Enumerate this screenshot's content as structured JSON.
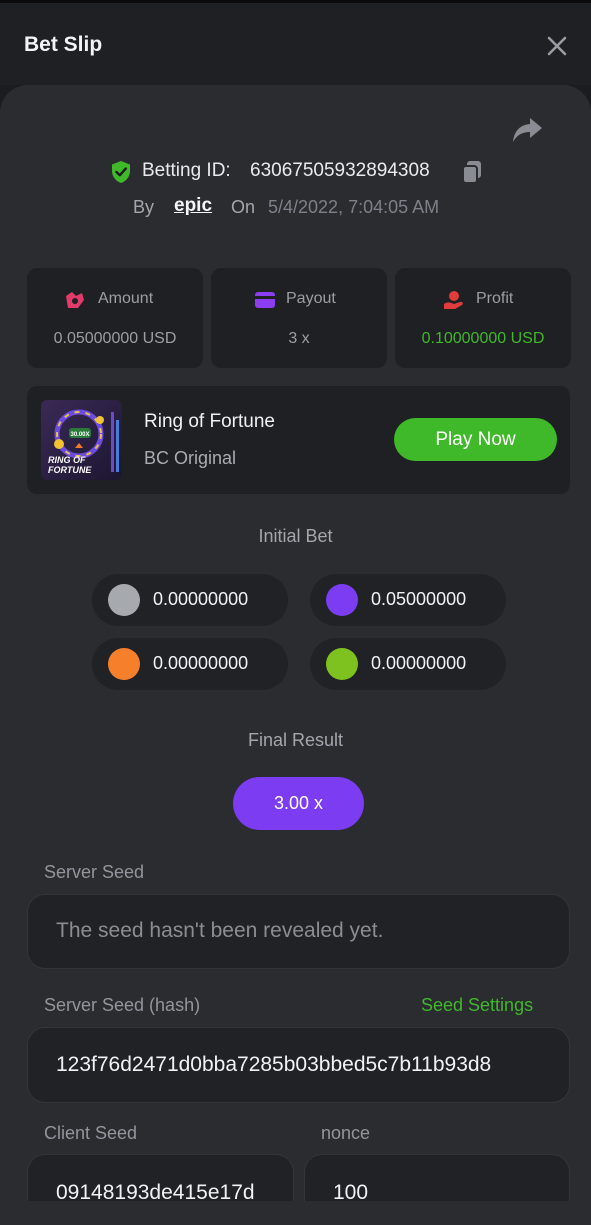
{
  "header": {
    "title": "Bet Slip"
  },
  "bet": {
    "id_label": "Betting ID:",
    "id": "63067505932894308",
    "by_label": "By",
    "user": "epic",
    "on_label": "On",
    "date": "5/4/2022, 7:04:05 AM"
  },
  "stats": [
    {
      "label": "Amount",
      "value": "0.05000000 USD",
      "icon": "amount-icon",
      "color": "#e23b6b"
    },
    {
      "label": "Payout",
      "value": "3 x",
      "icon": "payout-card-icon",
      "color": "#8b3df0"
    },
    {
      "label": "Profit",
      "value": "0.10000000 USD",
      "icon": "profit-icon",
      "color": "#e03c3c",
      "value_color": "#3fb82a"
    }
  ],
  "game": {
    "name": "Ring of Fortune",
    "subtitle": "BC Original",
    "play_label": "Play Now",
    "thumb_multiplier": "30.00X",
    "thumb_title_line1": "RING OF",
    "thumb_title_line2": "FORTUNE"
  },
  "initial_bet": {
    "title": "Initial Bet",
    "chips": [
      {
        "value": "0.00000000",
        "color": "#a6a9ae"
      },
      {
        "value": "0.05000000",
        "color": "#7b3cf2"
      },
      {
        "value": "0.00000000",
        "color": "#f57f2b"
      },
      {
        "value": "0.00000000",
        "color": "#7dc21e"
      }
    ]
  },
  "final_result": {
    "title": "Final Result",
    "value": "3.00 x"
  },
  "seeds": {
    "server_seed_label": "Server Seed",
    "server_seed_value": "The seed hasn't been revealed yet.",
    "server_hash_label": "Server Seed (hash)",
    "seed_settings_label": "Seed Settings",
    "server_hash_value": "123f76d2471d0bba7285b03bbed5c7b11b93d8",
    "client_seed_label": "Client Seed",
    "client_seed_value": "09148193de415e17d",
    "nonce_label": "nonce",
    "nonce_value": "100"
  },
  "colors": {
    "accent_green": "#3fb82a",
    "accent_purple": "#7b3cf2"
  }
}
